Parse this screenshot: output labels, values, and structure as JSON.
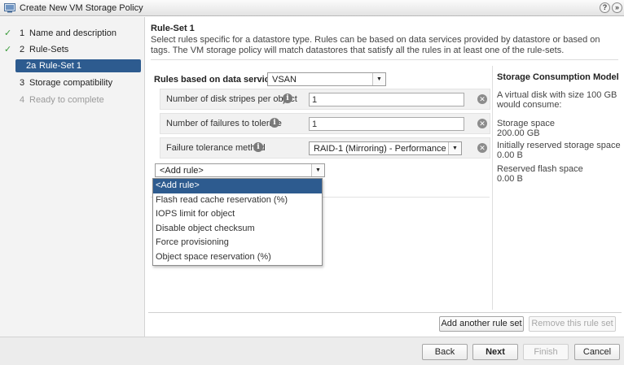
{
  "window": {
    "title": "Create New VM Storage Policy",
    "help_label": "?",
    "close_label": "»"
  },
  "steps": [
    {
      "num": "1",
      "label": "Name and description",
      "done": true
    },
    {
      "num": "2",
      "label": "Rule-Sets",
      "done": true
    },
    {
      "num": "2a",
      "label": "Rule-Set 1",
      "active": true
    },
    {
      "num": "3",
      "label": "Storage compatibility"
    },
    {
      "num": "4",
      "label": "Ready to complete",
      "disabled": true
    }
  ],
  "main": {
    "heading": "Rule-Set 1",
    "description": "Select rules specific for a datastore type. Rules can be based on data services provided by datastore or based on tags. The VM storage policy will match datastores that satisfy all the rules in at least one of the rule-sets.",
    "rules_label": "Rules based on data services",
    "datastore_type": "VSAN",
    "rules": [
      {
        "name": "Number of disk stripes per object",
        "value": "1"
      },
      {
        "name": "Number of failures to tolerate",
        "value": "1"
      },
      {
        "name": "Failure tolerance method",
        "value": "RAID-1 (Mirroring) - Performance"
      }
    ],
    "add_rule": {
      "selected": "<Add rule>",
      "options": [
        "<Add rule>",
        "Flash read cache reservation (%)",
        "IOPS limit for object",
        "Disable object checksum",
        "Force provisioning",
        "Object space reservation (%)"
      ]
    }
  },
  "storage_model": {
    "title": "Storage Consumption Model",
    "intro": [
      "A virtual disk with size 100 GB",
      "would consume:"
    ],
    "space_label": "Storage space",
    "space_value": "200.00 GB",
    "reserved_label": "Initially reserved storage space",
    "reserved_value": "0.00 B",
    "flash_label": "Reserved flash space",
    "flash_value": "0.00 B"
  },
  "ruleset_buttons": {
    "add": "Add another rule set",
    "remove": "Remove this rule set"
  },
  "footer": {
    "back": "Back",
    "next": "Next",
    "finish": "Finish",
    "cancel": "Cancel"
  }
}
